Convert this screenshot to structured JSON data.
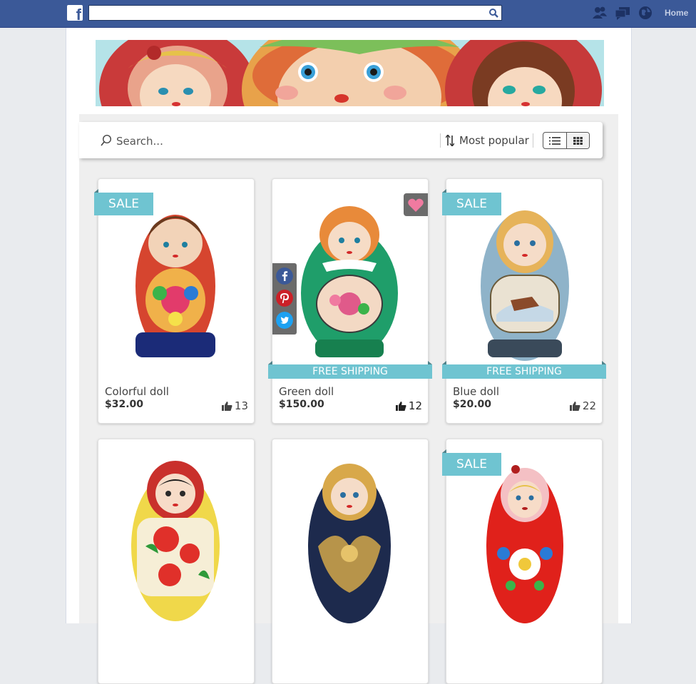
{
  "fb": {
    "logo_letter": "f",
    "search_value": "",
    "home_label": "Home",
    "nav_icons": [
      "friends-icon",
      "messages-icon",
      "notifications-globe-icon"
    ]
  },
  "toolbar": {
    "search_placeholder": "Search...",
    "sort_label": "Most popular",
    "view_options": [
      "list-view-icon",
      "grid-view-icon"
    ],
    "active_view": "grid"
  },
  "products": [
    {
      "name": "Colorful doll",
      "price": "$32.00",
      "likes": "13",
      "sale_label": "SALE",
      "shipping_label": "",
      "theme": "#d23a2a"
    },
    {
      "name": "Green doll",
      "price": "$150.00",
      "likes": "12",
      "sale_label": "",
      "shipping_label": "FREE SHIPPING",
      "theme": "#1f9e6a"
    },
    {
      "name": "Blue doll",
      "price": "$20.00",
      "likes": "22",
      "sale_label": "SALE",
      "shipping_label": "FREE SHIPPING",
      "theme": "#8fb3c9"
    },
    {
      "name": "",
      "price": "",
      "likes": "",
      "sale_label": "",
      "shipping_label": "",
      "theme": "#c9302c"
    },
    {
      "name": "",
      "price": "",
      "likes": "",
      "sale_label": "",
      "shipping_label": "",
      "theme": "#1d2a4d"
    },
    {
      "name": "",
      "price": "",
      "likes": "",
      "sale_label": "SALE",
      "shipping_label": "",
      "theme": "#e0211b"
    }
  ],
  "share_icons": [
    "facebook-icon",
    "pinterest-icon",
    "twitter-icon"
  ],
  "colors": {
    "fb_blue": "#3b5998",
    "accent_teal": "#6fc4d1",
    "favorite_pink": "#f07aa0"
  }
}
